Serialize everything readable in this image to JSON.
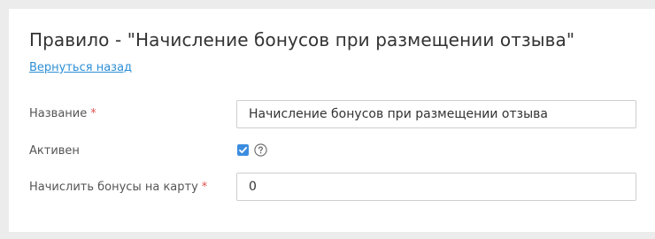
{
  "page": {
    "title": "Правило - \"Начисление бонусов при размещении отзыва\"",
    "back_link": "Вернуться назад"
  },
  "form": {
    "name": {
      "label": "Название",
      "required_mark": "*",
      "value": "Начисление бонусов при размещении отзыва"
    },
    "active": {
      "label": "Активен",
      "checked": true,
      "help_icon": "question-circle-icon"
    },
    "bonus": {
      "label": "Начислить бонусы на карту",
      "required_mark": "*",
      "value": "0"
    }
  },
  "colors": {
    "accent": "#3c8de0",
    "link": "#2e8fd6",
    "required": "#e05252",
    "background": "#ececec",
    "panel": "#ffffff"
  }
}
